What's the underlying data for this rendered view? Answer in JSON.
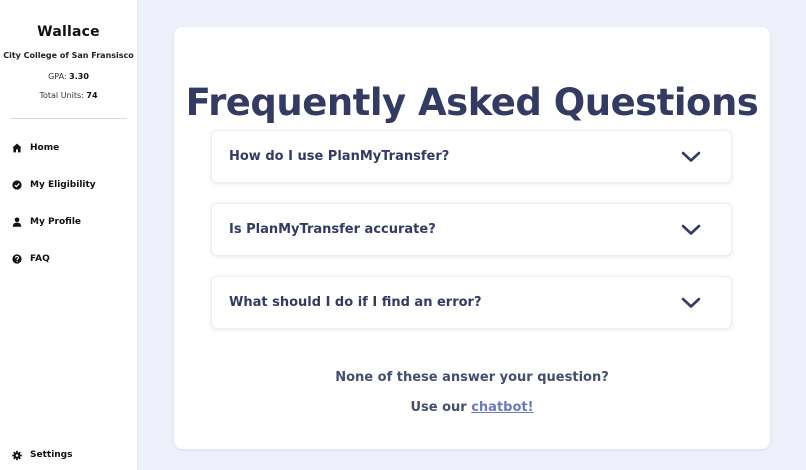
{
  "profile": {
    "name": "Wallace",
    "school": "City College of San Fransisco",
    "gpa_label": "GPA:",
    "gpa_value": "3.30",
    "units_label": "Total Units:",
    "units_value": "74"
  },
  "nav": {
    "items": [
      {
        "label": "Home",
        "icon": "home-icon"
      },
      {
        "label": "My Eligibility",
        "icon": "check-circle-icon"
      },
      {
        "label": "My Profile",
        "icon": "user-icon"
      },
      {
        "label": "FAQ",
        "icon": "question-circle-icon"
      }
    ],
    "settings": {
      "label": "Settings",
      "icon": "gear-icon"
    }
  },
  "main": {
    "title": "Frequently Asked Questions",
    "faqs": [
      {
        "question": "How do I use PlanMyTransfer?"
      },
      {
        "question": "Is PlanMyTransfer accurate?"
      },
      {
        "question": "What should I do if I find an error?"
      }
    ],
    "footer_question": "None of these answer your question?",
    "footer_prefix": "Use our",
    "chatbot_link": "chatbot!"
  },
  "colors": {
    "heading": "#343b63",
    "link": "#6a7bc2",
    "page_bg": "#eef0fb"
  }
}
